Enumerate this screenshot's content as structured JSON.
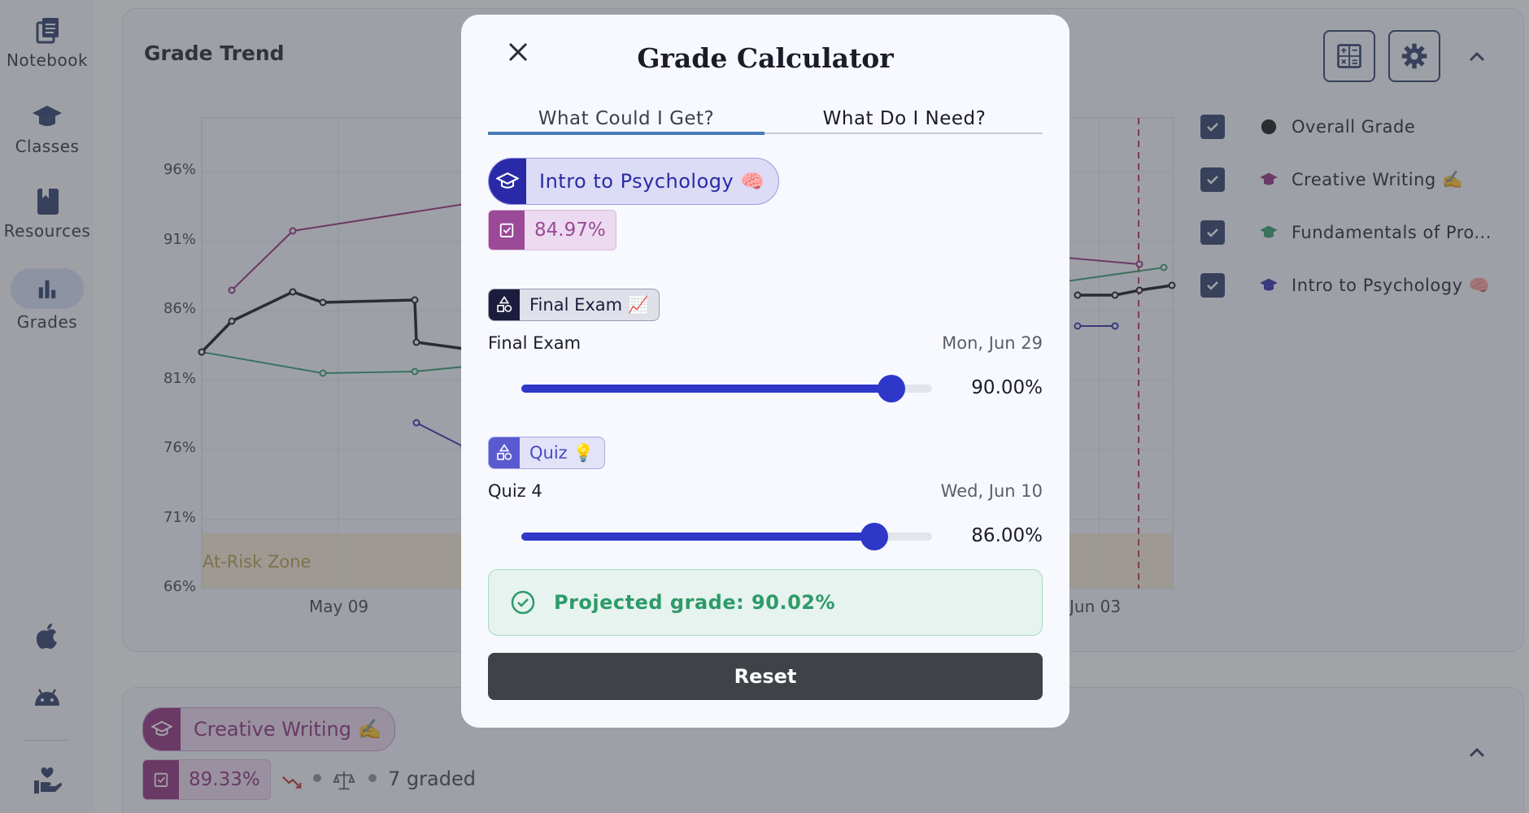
{
  "sidebar": {
    "items": [
      {
        "label": "Notebook",
        "icon": "notebook-icon"
      },
      {
        "label": "Classes",
        "icon": "graduation-cap-icon"
      },
      {
        "label": "Resources",
        "icon": "book-icon"
      },
      {
        "label": "Grades",
        "icon": "bar-chart-icon",
        "active": true
      }
    ],
    "bottom_icons": [
      "apple-icon",
      "android-icon",
      "donate-hand-icon"
    ]
  },
  "grade_trend": {
    "title": "Grade Trend",
    "at_risk_label": "At-Risk Zone",
    "tools": [
      "calculator-icon",
      "gear-icon",
      "chevron-up-icon"
    ]
  },
  "chart_data": {
    "type": "line",
    "title": "Grade Trend",
    "y_ticks": [
      "96%",
      "91%",
      "86%",
      "81%",
      "76%",
      "71%",
      "66%"
    ],
    "x_ticks": [
      "May 09",
      "Jun 03"
    ],
    "ylim": [
      66,
      100
    ],
    "grid": true,
    "legend_position": "right",
    "annotations": [
      "At-Risk Zone"
    ],
    "series": [
      {
        "name": "Overall Grade",
        "color": "#111111",
        "checked": true
      },
      {
        "name": "Creative Writing ✍️",
        "color": "#8e2a7a",
        "checked": true
      },
      {
        "name": "Fundamentals of Pro...",
        "color": "#2e9a6a",
        "checked": true
      },
      {
        "name": "Intro to Psychology 🧠",
        "color": "#2a2aa8",
        "checked": true
      }
    ]
  },
  "class_card": {
    "name": "Creative Writing ✍️",
    "grade": "89.33%",
    "graded": "7 graded"
  },
  "modal": {
    "title": "Grade Calculator",
    "tabs": [
      "What Could I Get?",
      "What Do I Need?"
    ],
    "active_tab": 0,
    "class_chip": "Intro to Psychology 🧠",
    "class_grade": "84.97%",
    "groups": [
      {
        "category": "Final Exam 📈",
        "category_color": "#1c1c3c",
        "assignment": "Final Exam",
        "date": "Mon, Jun 29",
        "value_label": "90.00%",
        "value": 0.9
      },
      {
        "category": "Quiz 💡",
        "category_color": "#5a5ad0",
        "assignment": "Quiz 4",
        "date": "Wed, Jun 10",
        "value_label": "86.00%",
        "value": 0.86
      }
    ],
    "projected": "Projected grade: 90.02%",
    "reset_label": "Reset"
  }
}
